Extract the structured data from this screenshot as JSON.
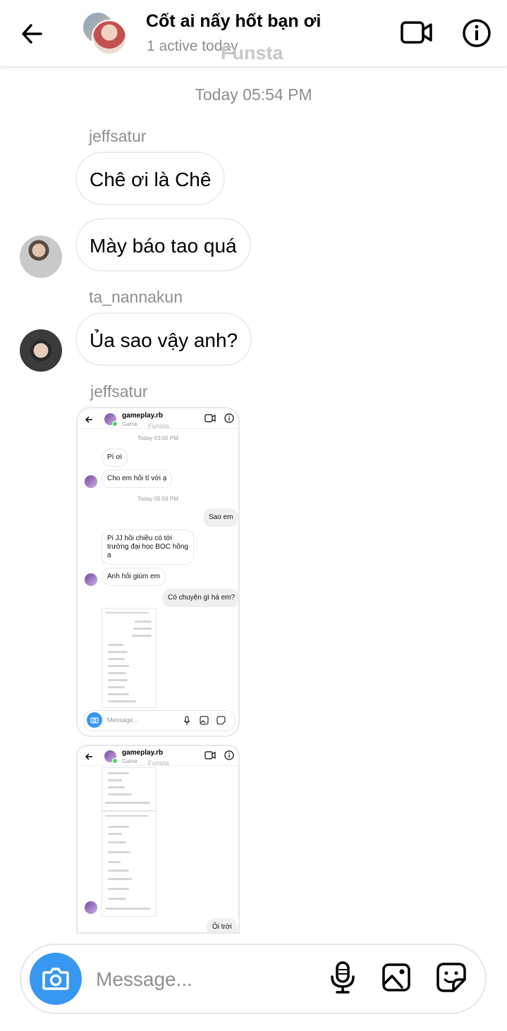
{
  "header": {
    "title": "Cốt ai nấy hốt bạn ơi",
    "subtitle": "1 active today",
    "watermark": "Funsta",
    "icons": [
      "back-arrow-icon",
      "video-call-icon",
      "info-icon"
    ]
  },
  "conversation": {
    "timestamp": "Today 05:54 PM",
    "messages": [
      {
        "sender": "jeffsatur",
        "text": "Chê ơi là Chê"
      },
      {
        "text": "Mày báo tao quá"
      },
      {
        "sender": "ta_nannakun",
        "text": "Ủa sao vậy anh?"
      },
      {
        "sender": "jeffsatur"
      }
    ]
  },
  "shot1": {
    "title": "gameplay.rb",
    "subtitle": "Game",
    "watermark": "Funsta",
    "ts1": "Today 03:00 PM",
    "m1": "Pí ơi",
    "m2": "Cho em hỏi tí với ạ",
    "ts2": "Today 05:56 PM",
    "m3": "Sao em",
    "m4a": "Pi JJ hồi chiều có tới",
    "m4b": "trường đại học BOC hông",
    "m4c": "ạ",
    "m5": "Anh hỏi giùm em",
    "m6": "Có chuyện gì há em?",
    "placeholder": "Message..."
  },
  "shot2": {
    "title": "gameplay.rb",
    "subtitle": "Game",
    "watermark": "Funsta",
    "last": "Ôi trời"
  },
  "composer": {
    "placeholder": "Message...",
    "icons": [
      "camera-icon",
      "microphone-icon",
      "gallery-icon",
      "sticker-icon"
    ]
  },
  "colors": {
    "accent": "#3897f0",
    "muted": "#8e8e8e",
    "bubble_border": "#ededed"
  }
}
